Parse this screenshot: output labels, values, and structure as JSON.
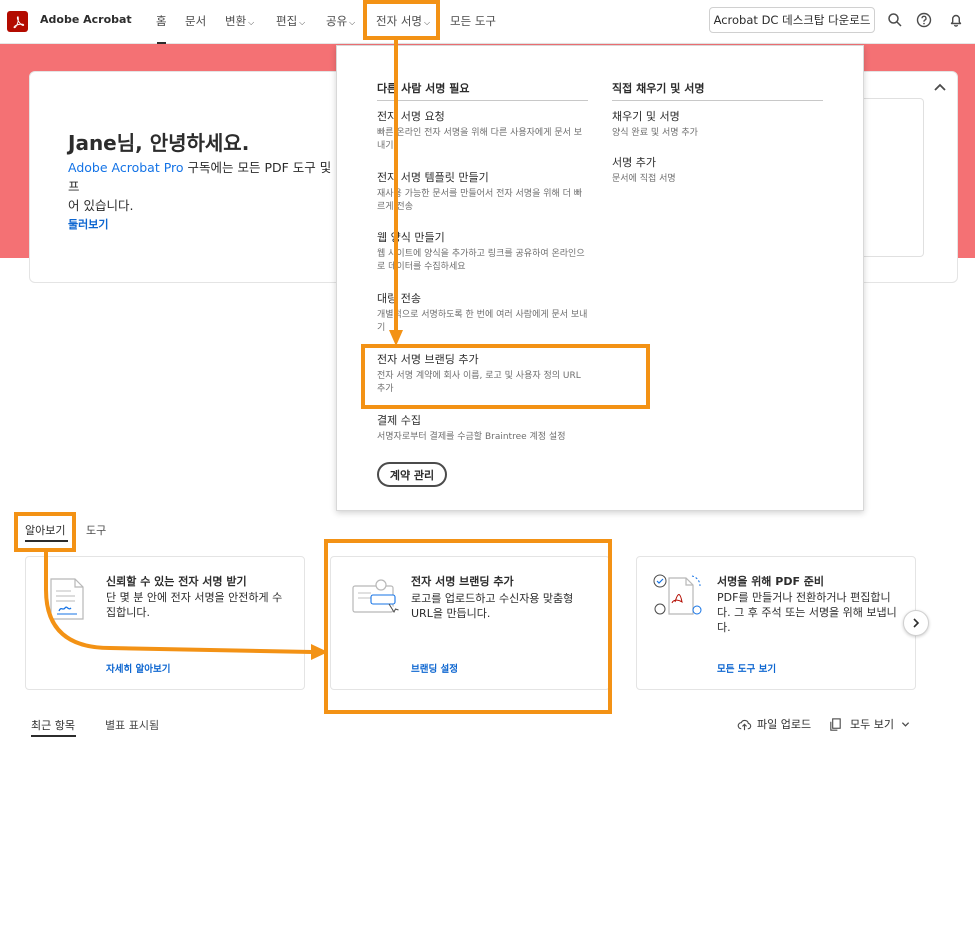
{
  "brand": {
    "name": "Adobe Acrobat"
  },
  "nav": {
    "home": "홈",
    "documents": "문서",
    "convert": "변환",
    "edit": "편집",
    "share": "공유",
    "esign": "전자 서명",
    "all_tools": "모든 도구",
    "desktop_download": "Acrobat DC 데스크탑 다운로드"
  },
  "hero": {
    "greeting": "Jane님, 안녕하세요.",
    "product_link": "Adobe Acrobat Pro",
    "text_rest": " 구독에는 모든 PDF 도구 및 프",
    "text_line2": "어 있습니다.",
    "browse": "둘러보기"
  },
  "dropdown": {
    "col1_title": "다른 사람 서명 필요",
    "col2_title": "직접 채우기 및 서명",
    "col1_items": [
      {
        "title": "전자 서명 요청",
        "desc": "빠른 온라인 전자 서명을 위해 다른 사용자에게 문서 보내기"
      },
      {
        "title": "전자 서명 템플릿 만들기",
        "desc": "재사용 가능한 문서를 만들어서 전자 서명을 위해 더 빠르게 전송"
      },
      {
        "title": "웹 양식 만들기",
        "desc": "웹 사이트에 양식을 추가하고 링크를 공유하여 온라인으로 데이터를 수집하세요"
      },
      {
        "title": "대량 전송",
        "desc": "개별적으로 서명하도록 한 번에 여러 사람에게 문서 보내기"
      },
      {
        "title": "전자 서명 브랜딩 추가",
        "desc": "전자 서명 계약에 회사 이름, 로고 및 사용자 정의 URL 추가"
      },
      {
        "title": "결제 수집",
        "desc": "서명자로부터 결제를 수금할 Braintree 계정 설정"
      }
    ],
    "col2_items": [
      {
        "title": "채우기 및 서명",
        "desc": "양식 완료 및 서명 추가"
      },
      {
        "title": "서명 추가",
        "desc": "문서에 직접 서명"
      }
    ],
    "manage_button": "계약 관리"
  },
  "tabs": {
    "learn": "알아보기",
    "tools": "도구"
  },
  "cards": [
    {
      "title": "신뢰할 수 있는 전자 서명 받기",
      "desc": "단 몇 분 안에 전자 서명을 안전하게 수집합니다.",
      "link": "자세히 알아보기"
    },
    {
      "title": "전자 서명 브랜딩 추가",
      "desc": "로고를 업로드하고 수신자용 맞춤형 URL을 만듭니다.",
      "link": "브랜딩 설정"
    },
    {
      "title": "서명을 위해 PDF 준비",
      "desc": "PDF를 만들거나 전환하거나 편집합니다. 그 후 주석 또는 서명을 위해 보냅니다.",
      "link": "모든 도구 보기"
    }
  ],
  "bottom": {
    "recent": "최근 항목",
    "starred": "별표 표시됨",
    "upload": "파일 업로드",
    "view_all": "모두 보기"
  },
  "colors": {
    "accent": "#f39215",
    "hero": "#f47174",
    "brand_red": "#b30b00",
    "link": "#0d66d0"
  }
}
